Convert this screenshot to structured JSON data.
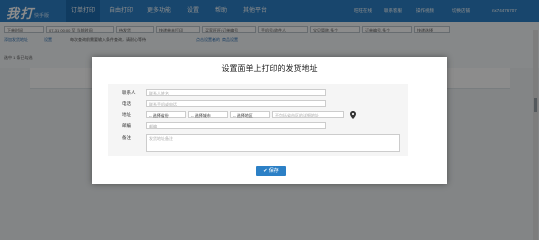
{
  "app": {
    "logo": "我打",
    "logo_sub": "快手版"
  },
  "nav": {
    "items": [
      "订单打印",
      "自由打印",
      "更多功能",
      "设置",
      "帮助",
      "其他平台"
    ]
  },
  "topbar_links": {
    "wangwang": "旺旺在线",
    "contact": "联系客服",
    "help": "操作视频",
    "login": "切换店铺",
    "user": "nx74476707"
  },
  "toolbar": {
    "filters": [
      "下单时间",
      "07-31 00:00 至 当前时间",
      "待发货",
      "快递单未打印",
      "买家旺旺/订单编号",
      "手机号/收件人",
      "宝贝简称,多个",
      "订单编号,多个",
      "快递选择"
    ],
    "links": [
      "添加发货地址",
      "设置",
      "每次查询前需要输入条件查询，请耐心等待",
      "点击设置者的",
      "商品设置"
    ],
    "status_line": "选中 1 条已勾选"
  },
  "modal": {
    "title": "设置面单上打印的发货地址",
    "fields": {
      "contact_label": "联系人",
      "contact_placeholder": "联系人姓名",
      "phone_label": "电话",
      "phone_placeholder": "联系手机或电话",
      "address_label": "地址",
      "province": "-- 选择省份",
      "city": "-- 选择城市",
      "district": "-- 选择地区",
      "street_placeholder": "不包括省市区的详细地址",
      "zip_label": "邮编",
      "zip_placeholder": "邮编",
      "note_label": "备注",
      "note_placeholder": "发货地址备注"
    },
    "save_label": "保存"
  }
}
